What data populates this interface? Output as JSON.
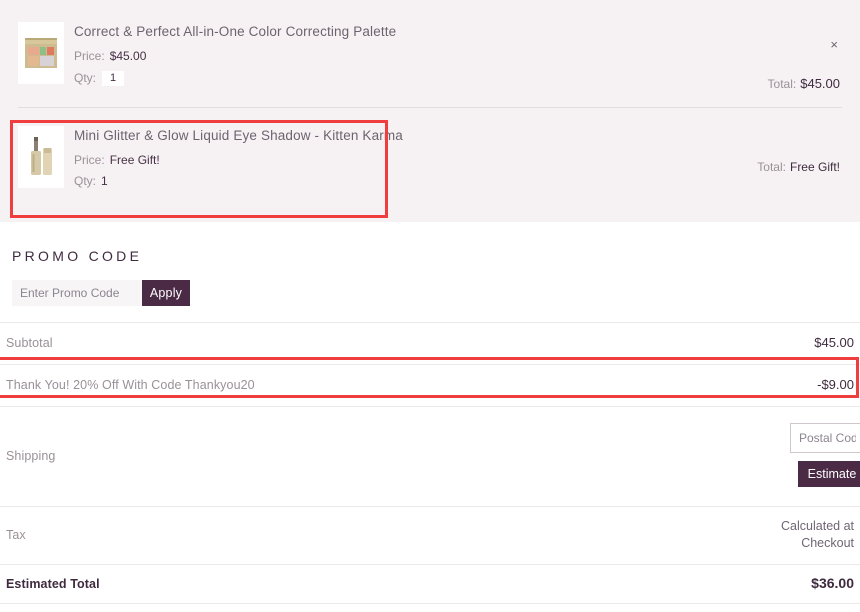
{
  "cart": {
    "items": [
      {
        "title": "Correct & Perfect All-in-One Color Correcting Palette",
        "price_label": "Price:",
        "price_value": "$45.00",
        "qty_label": "Qty:",
        "qty_value": "1",
        "total_label": "Total:",
        "total_value": "$45.00",
        "remove_icon": "close-x-icon",
        "remove_glyph": "×",
        "thumb": "color-correcting-palette-thumbnail"
      },
      {
        "title": "Mini Glitter & Glow Liquid Eye Shadow - Kitten Karma",
        "price_label": "Price:",
        "price_value": "Free Gift!",
        "qty_label": "Qty:",
        "qty_value": "1",
        "total_label": "Total:",
        "total_value": "Free Gift!",
        "thumb": "liquid-eye-shadow-thumbnail"
      }
    ]
  },
  "promo": {
    "heading": "PROMO CODE",
    "input_value": "",
    "input_placeholder": "Enter Promo Code",
    "apply_label": "Apply"
  },
  "summary": {
    "subtotal_label": "Subtotal",
    "subtotal_value": "$45.00",
    "discount_label": "Thank You! 20% Off With Code Thankyou20",
    "discount_value": "-$9.00",
    "shipping_label": "Shipping",
    "postal_value": "",
    "postal_placeholder": "Postal Code",
    "estimate_label": "Estimate",
    "tax_label": "Tax",
    "tax_value": "Calculated at\nCheckout",
    "tax_value_line1": "Calculated at",
    "tax_value_line2": "Checkout",
    "total_label": "Estimated Total",
    "total_value": "$36.00"
  },
  "colors": {
    "accent": "#4a2a44",
    "cart_bg": "#f6f2f3",
    "highlight": "#f03d3d",
    "muted_text": "#9a9198",
    "dark_text": "#3f2b3f"
  }
}
